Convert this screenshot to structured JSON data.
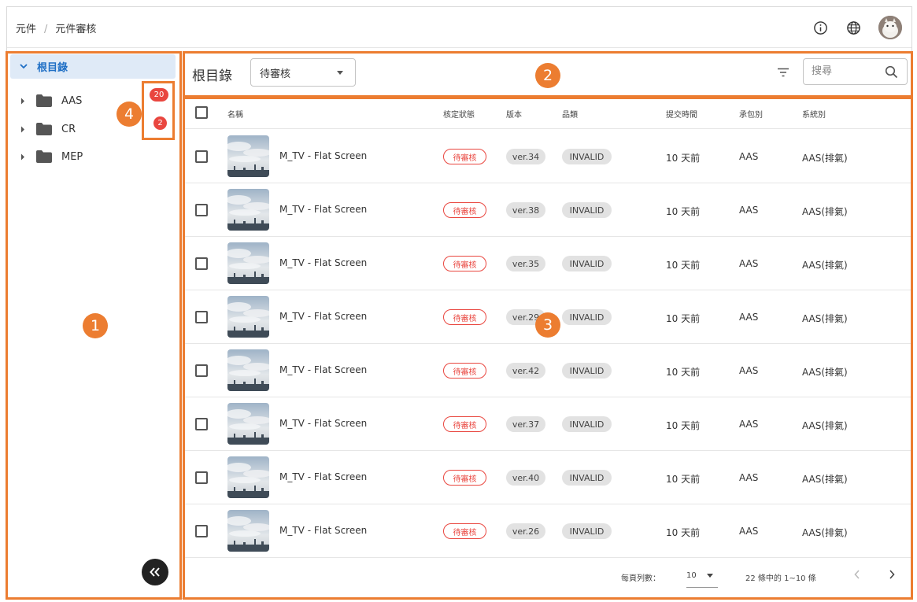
{
  "breadcrumb": {
    "root": "元件",
    "current": "元件審核",
    "separator": "/"
  },
  "header_icons": [
    "info-icon",
    "globe-icon",
    "avatar"
  ],
  "sidebar": {
    "root_label": "根目錄",
    "items": [
      {
        "label": "AAS",
        "badge": "20"
      },
      {
        "label": "CR",
        "badge": "2"
      },
      {
        "label": "MEP",
        "badge": ""
      }
    ]
  },
  "toolbar": {
    "title": "根目錄",
    "status_selected": "待審核",
    "search_placeholder": "搜尋"
  },
  "table": {
    "columns": [
      "名稱",
      "核定狀態",
      "版本",
      "品類",
      "提交時間",
      "承包別",
      "系統別"
    ],
    "rows": [
      {
        "name": "M_TV - Flat Screen",
        "status": "待審核",
        "version": "ver.34",
        "quality": "INVALID",
        "submitted": "10 天前",
        "contractor": "AAS",
        "system": "AAS(排氣)"
      },
      {
        "name": "M_TV - Flat Screen",
        "status": "待審核",
        "version": "ver.38",
        "quality": "INVALID",
        "submitted": "10 天前",
        "contractor": "AAS",
        "system": "AAS(排氣)"
      },
      {
        "name": "M_TV - Flat Screen",
        "status": "待審核",
        "version": "ver.35",
        "quality": "INVALID",
        "submitted": "10 天前",
        "contractor": "AAS",
        "system": "AAS(排氣)"
      },
      {
        "name": "M_TV - Flat Screen",
        "status": "待審核",
        "version": "ver.29",
        "quality": "INVALID",
        "submitted": "10 天前",
        "contractor": "AAS",
        "system": "AAS(排氣)"
      },
      {
        "name": "M_TV - Flat Screen",
        "status": "待審核",
        "version": "ver.42",
        "quality": "INVALID",
        "submitted": "10 天前",
        "contractor": "AAS",
        "system": "AAS(排氣)"
      },
      {
        "name": "M_TV - Flat Screen",
        "status": "待審核",
        "version": "ver.37",
        "quality": "INVALID",
        "submitted": "10 天前",
        "contractor": "AAS",
        "system": "AAS(排氣)"
      },
      {
        "name": "M_TV - Flat Screen",
        "status": "待審核",
        "version": "ver.40",
        "quality": "INVALID",
        "submitted": "10 天前",
        "contractor": "AAS",
        "system": "AAS(排氣)"
      },
      {
        "name": "M_TV - Flat Screen",
        "status": "待審核",
        "version": "ver.26",
        "quality": "INVALID",
        "submitted": "10 天前",
        "contractor": "AAS",
        "system": "AAS(排氣)"
      }
    ]
  },
  "pagination": {
    "rows_per_page_label": "每頁列數：",
    "rows_per_page": "10",
    "range_text": "22 條中的 1~10 條"
  },
  "annotations": {
    "n1": "1",
    "n2": "2",
    "n3": "3",
    "n4": "4"
  },
  "colors": {
    "accent": "#ec7d31",
    "badge": "#e9463f",
    "primary": "#1f6fc5"
  }
}
